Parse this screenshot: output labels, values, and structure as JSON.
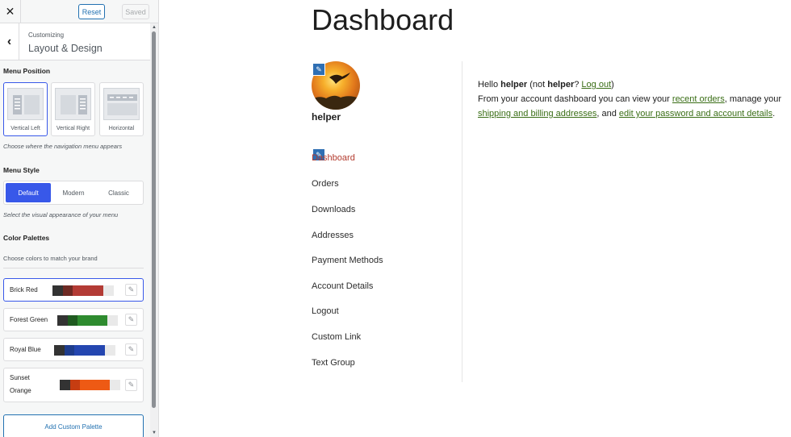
{
  "customizer": {
    "reset_label": "Reset",
    "saved_label": "Saved",
    "breadcrumb": "Customizing",
    "title": "Layout & Design",
    "menu_position": {
      "title": "Menu Position",
      "options": [
        "Vertical Left",
        "Vertical Right",
        "Horizontal"
      ],
      "selected": "Vertical Left",
      "description": "Choose where the navigation menu appears"
    },
    "menu_style": {
      "title": "Menu Style",
      "options": [
        "Default",
        "Modern",
        "Classic"
      ],
      "selected": "Default",
      "description": "Select the visual appearance of your menu"
    },
    "color_palettes": {
      "title": "Color Palettes",
      "description": "Choose colors to match your brand",
      "selected": "Brick Red",
      "palettes": [
        {
          "name": "Brick Red",
          "colors": [
            "#333333",
            "#6e2a24",
            "#b33b35",
            "#e9e9e9"
          ]
        },
        {
          "name": "Forest Green",
          "colors": [
            "#333333",
            "#1f5a20",
            "#2e8b2f",
            "#e9e9e9"
          ]
        },
        {
          "name": "Royal Blue",
          "colors": [
            "#333333",
            "#1e3c8c",
            "#2446b0",
            "#e9e9e9"
          ]
        },
        {
          "name": "Sunset Orange",
          "colors": [
            "#333333",
            "#c63d12",
            "#ee5a14",
            "#e9e9e9"
          ]
        }
      ],
      "add_label": "Add Custom Palette"
    },
    "accent": "#3858e9"
  },
  "preview": {
    "page_title": "Dashboard",
    "username": "helper",
    "nav": [
      "Dashboard",
      "Orders",
      "Downloads",
      "Addresses",
      "Payment Methods",
      "Account Details",
      "Logout",
      "Custom Link",
      "Text Group"
    ],
    "active_nav": "Dashboard",
    "hello_prefix": "Hello ",
    "hello_user": "helper",
    "hello_not": " (not ",
    "hello_not_user": "helper",
    "hello_q": "? ",
    "logout_link": "Log out",
    "hello_close": ")",
    "intro_prefix": "From your account dashboard you can view your ",
    "recent_orders_link": "recent orders",
    "intro_mid": ", manage your ",
    "addresses_link": "shipping and billing addresses",
    "intro_and": ", and ",
    "password_link": "edit your password and account details",
    "intro_end": "."
  }
}
